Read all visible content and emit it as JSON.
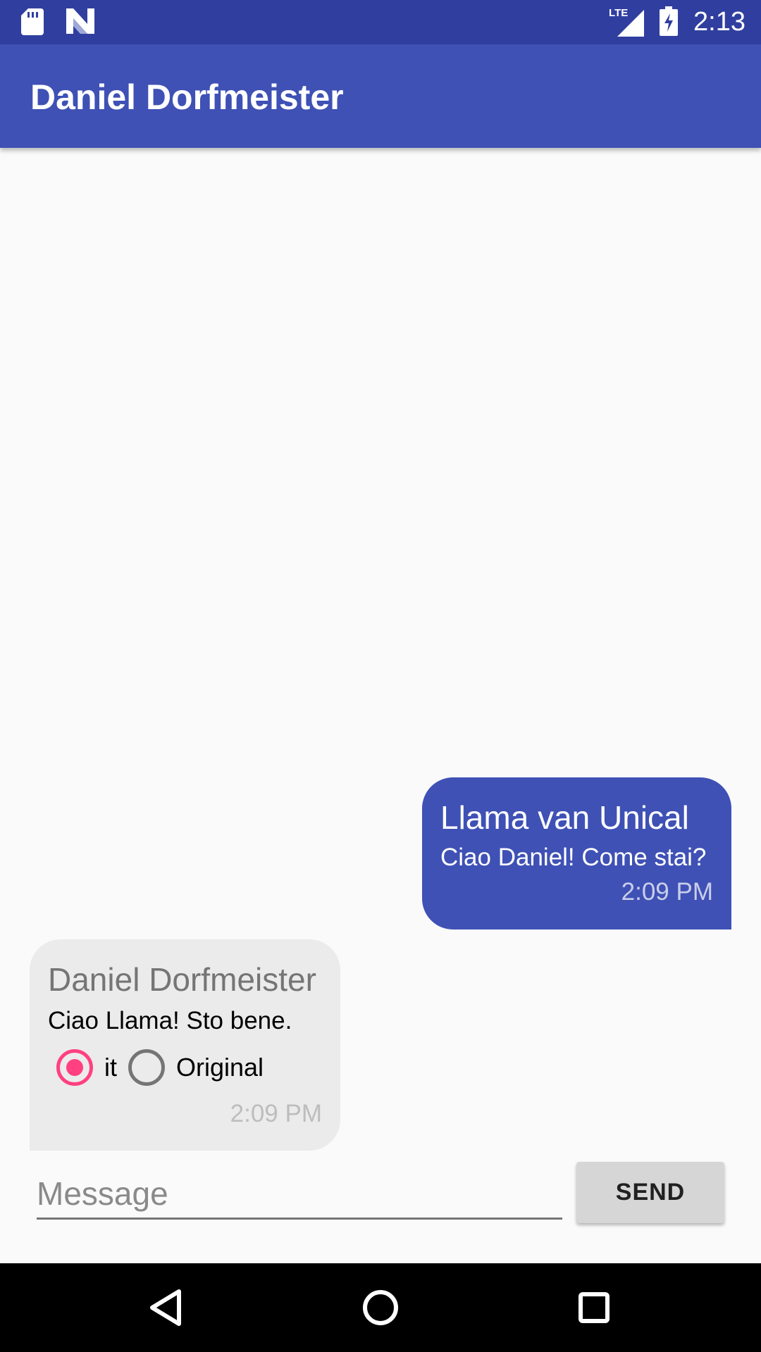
{
  "status_bar": {
    "time": "2:13",
    "network_label": "LTE",
    "icons": [
      "sd-card-icon",
      "notification-n-icon",
      "signal-icon",
      "battery-charging-icon"
    ]
  },
  "app_bar": {
    "title": "Daniel Dorfmeister"
  },
  "messages": [
    {
      "direction": "outgoing",
      "sender": "Llama van Unical",
      "text": "Ciao Daniel! Come stai?",
      "time": "2:09 PM"
    },
    {
      "direction": "incoming",
      "sender": "Daniel Dorfmeister",
      "text": "Ciao Llama! Sto bene.",
      "time": "2:09 PM",
      "language_options": [
        {
          "label": "it",
          "selected": true
        },
        {
          "label": "Original",
          "selected": false
        }
      ]
    }
  ],
  "composer": {
    "placeholder": "Message",
    "value": "",
    "send_label": "SEND"
  },
  "colors": {
    "primary": "#3f51b5",
    "primary_dark": "#303f9f",
    "accent": "#ff4081",
    "incoming_bubble": "#ebebeb"
  },
  "nav_bar": {
    "icons": [
      "back-icon",
      "home-icon",
      "recents-icon"
    ]
  }
}
